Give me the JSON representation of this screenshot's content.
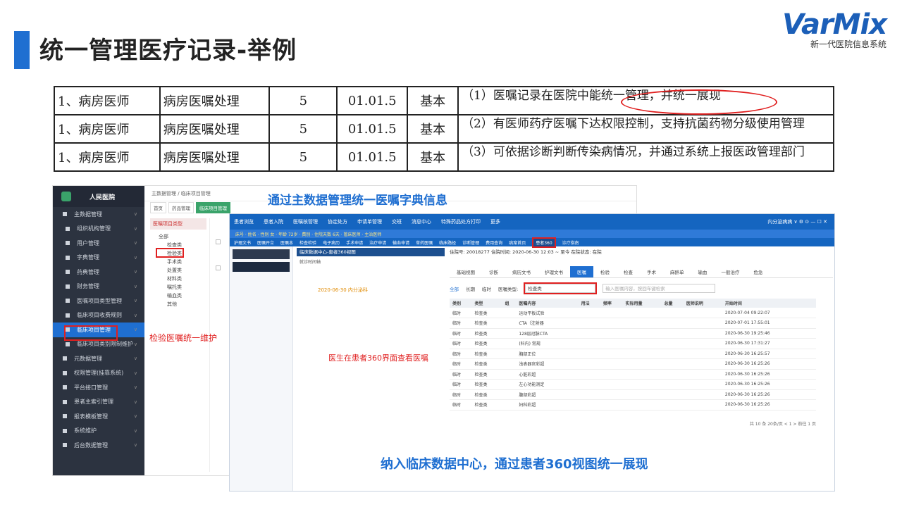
{
  "slide": {
    "title": "统一管理医疗记录-举例",
    "logo_brand": "VarMix",
    "logo_tagline": "新一代医院信息系统"
  },
  "requirements": [
    [
      "1、病房医师",
      "病房医嘱处理",
      "5",
      "01.01.5",
      "基本",
      "（1）医嘱记录在医院中能统一管理，并统一展现"
    ],
    [
      "1、病房医师",
      "病房医嘱处理",
      "5",
      "01.01.5",
      "基本",
      "（2）有医师药疗医嘱下达权限控制，支持抗菌药物分级使用管理"
    ],
    [
      "1、病房医师",
      "病房医嘱处理",
      "5",
      "01.01.5",
      "基本",
      "（3）可依据诊断判断传染病情况，并通过系统上报医政管理部门"
    ]
  ],
  "annotations": {
    "master_data": "通过主数据管理统一医嘱字典信息",
    "lab_orders": "检验医嘱统一维护",
    "doctor_view": "医生在患者360界面查看医嘱",
    "cdr": "纳入临床数据中心，通过患者360视图统一展现"
  },
  "admin_ui": {
    "hospital": "人民医院",
    "breadcrumb": "主数据管理 / 临床项目管理",
    "tabs": [
      "首页",
      "药品管理",
      "临床项目管理"
    ],
    "menu": [
      {
        "label": "主数据管理",
        "level": 0
      },
      {
        "label": "组织机构管理",
        "level": 1
      },
      {
        "label": "用户管理",
        "level": 1
      },
      {
        "label": "字典管理",
        "level": 1
      },
      {
        "label": "药典管理",
        "level": 1
      },
      {
        "label": "财务管理",
        "level": 1
      },
      {
        "label": "医嘱项目类型管理",
        "level": 1
      },
      {
        "label": "临床项目收费规则",
        "level": 1
      },
      {
        "label": "临床项目管理",
        "level": 1,
        "active": true
      },
      {
        "label": "临床项目类别限制维护",
        "level": 1
      },
      {
        "label": "元数据管理",
        "level": 0
      },
      {
        "label": "权限管理(挂靠系统)",
        "level": 0
      },
      {
        "label": "平台接口管理",
        "level": 0
      },
      {
        "label": "患者主索引管理",
        "level": 0
      },
      {
        "label": "报表模板管理",
        "level": 0
      },
      {
        "label": "系统维护",
        "level": 0
      },
      {
        "label": "后台数据管理",
        "level": 0
      }
    ],
    "tree_header": "医嘱项目类型",
    "tree": [
      {
        "label": "全部",
        "indent": false
      },
      {
        "label": "检查类",
        "indent": true
      },
      {
        "label": "检验类",
        "indent": true
      },
      {
        "label": "手术类",
        "indent": true
      },
      {
        "label": "处置类",
        "indent": true
      },
      {
        "label": "材料类",
        "indent": true
      },
      {
        "label": "嘱托类",
        "indent": true
      },
      {
        "label": "输血类",
        "indent": true
      },
      {
        "label": "其他",
        "indent": true
      }
    ]
  },
  "patient360": {
    "panel_title": "临床数据中心-患者360视图",
    "timeline_label": "就诊时间轴",
    "timeline_event": "2020-06-30 内分泌科",
    "header_info": "住院号: 20018277  住院时间: 2020-06-30 12:03 ~ 至今  在院状态: 在院",
    "active_menu": "患者360",
    "menus": [
      "护理文书",
      "医嘱开立",
      "医嘱本",
      "检查检验",
      "电子病历",
      "手术申请",
      "治疗申请",
      "输血申请",
      "草药医嘱",
      "临床路径",
      "诊断管理",
      "费用查询",
      "病案首页",
      "患者360",
      "诊疗指南"
    ],
    "tabs": [
      "基础视图",
      "诊断",
      "病历文书",
      "护理文书",
      "医嘱",
      "检验",
      "检查",
      "手术",
      "麻醉单",
      "输血",
      "一般治疗",
      "危急"
    ],
    "active_tab": "医嘱",
    "filter_all": "全部",
    "filter_long": "长期",
    "filter_temp": "临时",
    "order_type_label": "医嘱类型:",
    "order_type_value": "检查类",
    "search_placeholder": "输入医嘱内容，按回车键检索",
    "columns": [
      "类别",
      "类型",
      "组",
      "医嘱内容",
      "用法",
      "频率",
      "实际用量",
      "总量",
      "医师说明",
      "开始时间"
    ],
    "rows": [
      [
        "临时",
        "检查类",
        "",
        "运动平板试验",
        "",
        "",
        "",
        "",
        "",
        "2020-07-04 09:22:07"
      ],
      [
        "临时",
        "检查类",
        "",
        "CTA（注射器",
        "",
        "",
        "",
        "",
        "",
        "2020-07-01 17:55:01"
      ],
      [
        "临时",
        "检查类",
        "",
        "128层冠脉CTA",
        "",
        "",
        "",
        "",
        "",
        "2020-06-30 19:25:46"
      ],
      [
        "临时",
        "检查类",
        "",
        "(科内) 常规",
        "",
        "",
        "",
        "",
        "",
        "2020-06-30 17:31:27"
      ],
      [
        "临时",
        "检查类",
        "",
        "胸部正位",
        "",
        "",
        "",
        "",
        "",
        "2020-06-30 16:25:57"
      ],
      [
        "临时",
        "检查类",
        "",
        "浅表器官彩超",
        "",
        "",
        "",
        "",
        "",
        "2020-06-30 16:25:26"
      ],
      [
        "临时",
        "检查类",
        "",
        "心脏彩超",
        "",
        "",
        "",
        "",
        "",
        "2020-06-30 16:25:26"
      ],
      [
        "临时",
        "检查类",
        "",
        "左心功能测定",
        "",
        "",
        "",
        "",
        "",
        "2020-06-30 16:25:26"
      ],
      [
        "临时",
        "检查类",
        "",
        "腹部彩超",
        "",
        "",
        "",
        "",
        "",
        "2020-06-30 16:25:26"
      ],
      [
        "临时",
        "检查类",
        "",
        "妇科彩超",
        "",
        "",
        "",
        "",
        "",
        "2020-06-30 16:25:26"
      ]
    ],
    "pager": "共 10 条   20条/页   <  1  >   前往  1  页"
  }
}
